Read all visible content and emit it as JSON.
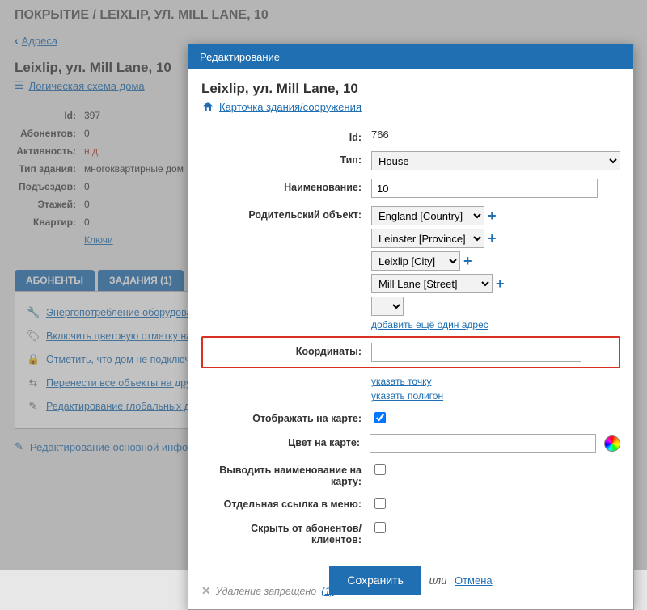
{
  "page": {
    "breadcrumb": "ПОКРЫТИЕ / LEIXLIP, УЛ. MILL LANE, 10",
    "back": "Адреса",
    "title": "Leixlip, ул. Mill Lane, 10",
    "scheme_link": "Логическая схема дома"
  },
  "info": {
    "id_label": "Id:",
    "id": "397",
    "subs_label": "Абонентов:",
    "subs": "0",
    "act_label": "Активность:",
    "act": "н.д.",
    "type_label": "Тип здания:",
    "type": "многоквартирные дом",
    "ent_label": "Подъездов:",
    "ent": "0",
    "floors_label": "Этажей:",
    "floors": "0",
    "flats_label": "Квартир:",
    "flats": "0",
    "keys": "Ключи"
  },
  "tabs": {
    "t1": "АБОНЕНТЫ",
    "t2": "ЗАДАНИЯ (1)"
  },
  "actions": {
    "a1": "Энергопотребление оборудования",
    "a2": "Включить цветовую отметку на д",
    "a3": "Отметить, что дом не подключен",
    "a4": "Перенести все объекты на другой",
    "a5": "Редактирование глобальных дан"
  },
  "edit_main": "Редактирование основной информ",
  "modal": {
    "header": "Редактирование",
    "title": "Leixlip, ул. Mill Lane, 10",
    "card_link": "Карточка здания/сооружения",
    "labels": {
      "id": "Id:",
      "type": "Тип:",
      "name": "Наименование:",
      "parent": "Родительский объект:",
      "coords": "Координаты:",
      "show_map": "Отображать на карте:",
      "map_color": "Цвет на карте:",
      "show_name": "Выводить наименование на карту:",
      "menu_link": "Отдельная ссылка в меню:",
      "hide": "Скрыть от абонентов/клиентов:"
    },
    "values": {
      "id": "766",
      "type": "House",
      "name": "10",
      "parent1": "England [Country]",
      "parent2": "Leinster [Province]",
      "parent3": "Leixlip [City]",
      "parent4": "Mill Lane [Street]",
      "add_more": "добавить ещё один адрес",
      "point": "указать точку",
      "polygon": "указать полигон",
      "coords": ""
    },
    "footer": {
      "save": "Сохранить",
      "or": "или",
      "cancel": "Отмена",
      "del": "Удаление запрещено",
      "del_n": "(1)"
    }
  }
}
